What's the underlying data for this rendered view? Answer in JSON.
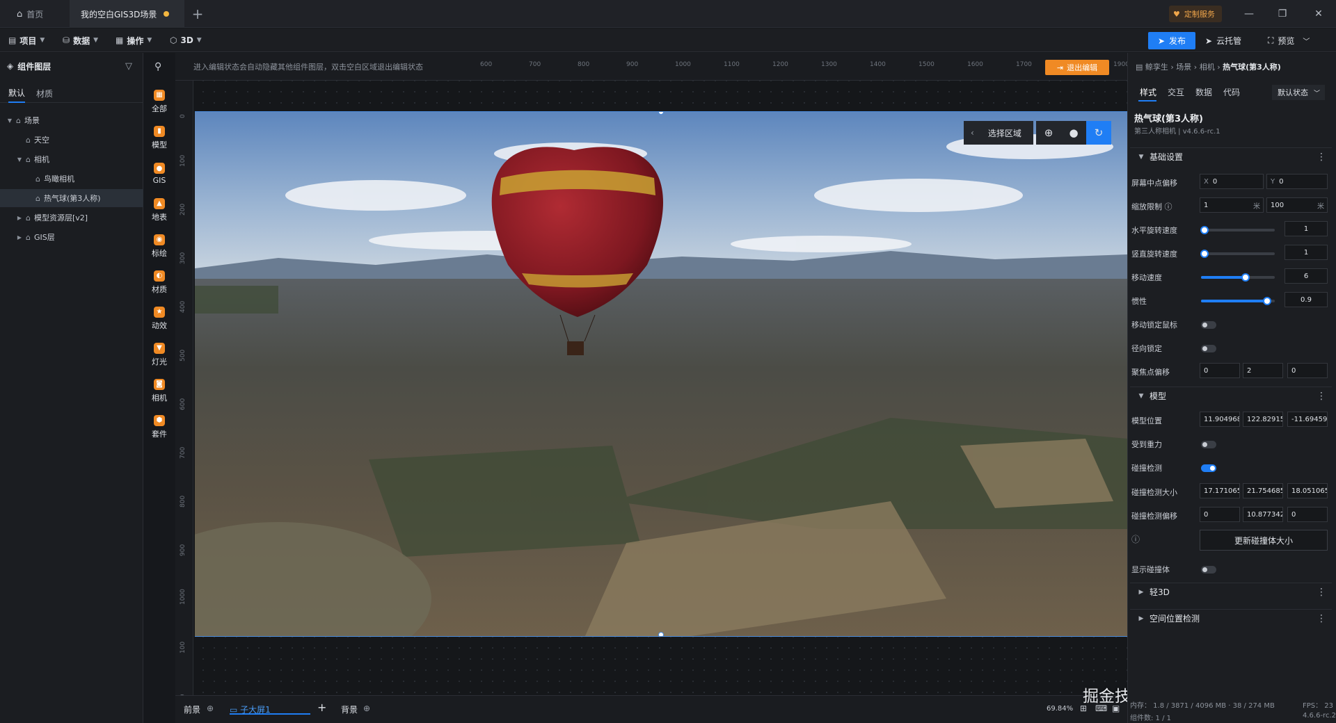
{
  "titlebar": {
    "home_tab": "首页",
    "scene_tab": "我的空白GIS3D场景",
    "add_tab": "+",
    "custom_service": "定制服务",
    "minimize": "—",
    "restore": "❐",
    "close": "✕"
  },
  "menubar": {
    "project": "项目",
    "data": "数据",
    "operation": "操作",
    "mode": "3D",
    "publish": "发布",
    "cloud_hosting": "云托管",
    "preview": "预览"
  },
  "left_panel": {
    "title": "组件图层",
    "tabs": [
      "默认",
      "材质"
    ],
    "tree": [
      {
        "label": "场景",
        "indent": 0,
        "arrow": "▼"
      },
      {
        "label": "天空",
        "indent": 1,
        "arrow": ""
      },
      {
        "label": "相机",
        "indent": 1,
        "arrow": "▼"
      },
      {
        "label": "鸟瞰相机",
        "indent": 2,
        "arrow": ""
      },
      {
        "label": "热气球(第3人称)",
        "indent": 2,
        "arrow": "",
        "selected": true
      },
      {
        "label": "模型资源层[v2]",
        "indent": 1,
        "arrow": "▶"
      },
      {
        "label": "GIS层",
        "indent": 1,
        "arrow": "▶"
      }
    ]
  },
  "icon_strip": [
    {
      "label": "全部",
      "icon": "grid-icon",
      "color": "#f08a24"
    },
    {
      "label": "模型",
      "icon": "model-icon",
      "color": "#f08a24"
    },
    {
      "label": "GIS",
      "icon": "globe-icon",
      "color": "#f08a24"
    },
    {
      "label": "地表",
      "icon": "terrain-icon",
      "color": "#f08a24"
    },
    {
      "label": "标绘",
      "icon": "pin-icon",
      "color": "#f08a24"
    },
    {
      "label": "材质",
      "icon": "material-icon",
      "color": "#f08a24"
    },
    {
      "label": "动效",
      "icon": "star-icon",
      "color": "#f08a24"
    },
    {
      "label": "灯光",
      "icon": "light-icon",
      "color": "#f08a24"
    },
    {
      "label": "相机",
      "icon": "camera-icon",
      "color": "#f08a24"
    },
    {
      "label": "套件",
      "icon": "kit-icon",
      "color": "#f08a24"
    }
  ],
  "canvas": {
    "hint": "进入编辑状态会自动隐藏其他组件图层，双击空白区域退出编辑状态",
    "exit_edit": "退出编辑",
    "top_ruler": [
      "600",
      "700",
      "800",
      "900",
      "1000",
      "1100",
      "1200",
      "1300",
      "1400",
      "1500",
      "1600",
      "1700",
      "1800",
      "1900"
    ],
    "left_ruler": [
      "0",
      "100",
      "200",
      "300",
      "400",
      "500",
      "600",
      "700",
      "800",
      "900",
      "1000",
      "100",
      "00"
    ],
    "select_region": "选择区域"
  },
  "bottombar": {
    "foreground": "前景",
    "sub_screen": "子大屏1",
    "add": "+",
    "background": "背景",
    "zoom": "69.84%",
    "watermark": "掘金技术社区 @ 山海鲸可视化",
    "memory": "内存： 1.8 / 3871 / 4096 MB · 38 / 274 MB",
    "fps": "FPS： 23",
    "component_count": "组件数: 1 / 1",
    "version": "4.6.6-rc.2"
  },
  "right_panel": {
    "breadcrumb": [
      "鲸孪生",
      "场景",
      "相机",
      "热气球(第3人称)"
    ],
    "tabs": [
      "样式",
      "交互",
      "数据",
      "代码"
    ],
    "state": "默认状态",
    "component_title": "热气球(第3人称)",
    "component_sub": "第三人称相机 | v4.6.6-rc.1",
    "sections": {
      "basic": "基础设置",
      "model": "模型",
      "light3d": "轻3D",
      "spatial": "空间位置检测"
    },
    "props": {
      "screen_center_offset": {
        "label": "屏幕中点偏移",
        "x": "0",
        "y": "0"
      },
      "zoom_limit": {
        "label": "缩放限制",
        "min": "1",
        "max": "100",
        "unit": "米"
      },
      "h_rotate_speed": {
        "label": "水平旋转速度",
        "value": "1",
        "fraction": 0.05
      },
      "v_rotate_speed": {
        "label": "竖直旋转速度",
        "value": "1",
        "fraction": 0.05
      },
      "move_speed": {
        "label": "移动速度",
        "value": "6",
        "fraction": 0.6
      },
      "inertia": {
        "label": "惯性",
        "value": "0.9",
        "fraction": 0.9
      },
      "move_lock_mouse": {
        "label": "移动锁定鼠标",
        "on": false
      },
      "radial_lock": {
        "label": "径向锁定",
        "on": false
      },
      "focus_offset": {
        "label": "聚焦点偏移",
        "values": [
          "0",
          "2",
          "0"
        ]
      },
      "model_position": {
        "label": "模型位置",
        "values": [
          "11.904968",
          "122.82915",
          "-11.694591"
        ]
      },
      "gravity": {
        "label": "受到重力",
        "on": false
      },
      "collision": {
        "label": "碰撞检测",
        "on": true
      },
      "collision_size": {
        "label": "碰撞检测大小",
        "values": [
          "17.1710653",
          "21.754685",
          "18.051065"
        ]
      },
      "collision_offset": {
        "label": "碰撞检测偏移",
        "values": [
          "0",
          "10.877342",
          "0"
        ]
      },
      "update_collider": "更新碰撞体大小",
      "show_collider": {
        "label": "显示碰撞体",
        "on": false
      }
    }
  },
  "colors": {
    "accent": "#1f7ef5",
    "orange": "#f08a24",
    "balloon_red": "#8e1a22",
    "balloon_stripe": "#c9a233"
  }
}
